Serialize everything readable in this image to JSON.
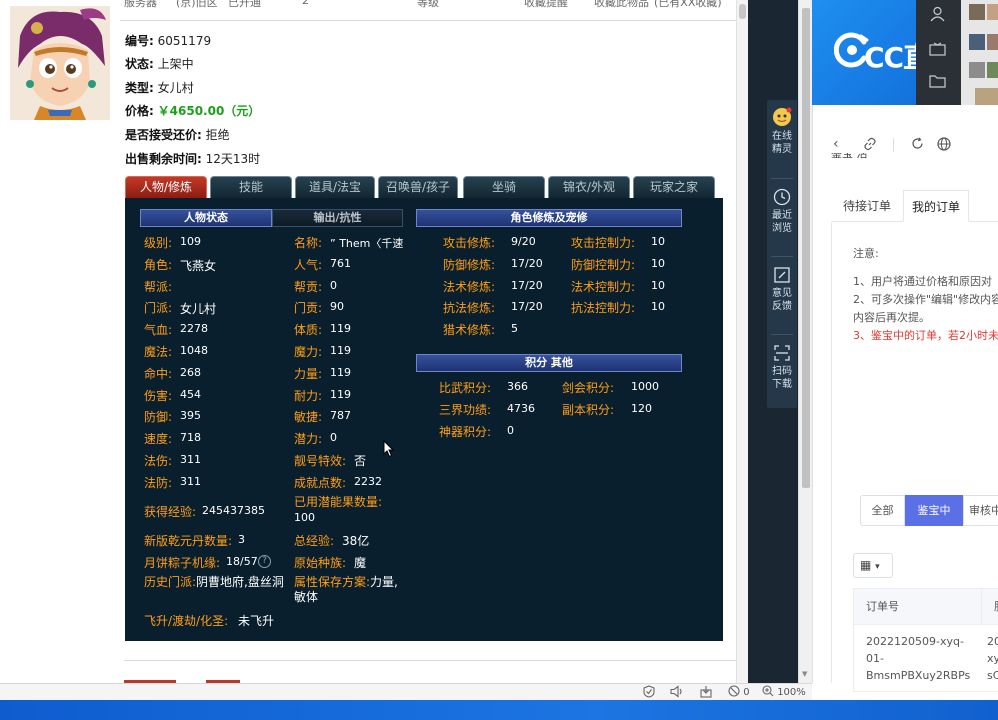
{
  "top_cut": [
    "服务器",
    "(京)旧区",
    "已开通",
    "2",
    "服务",
    "等级",
    "收藏提醒",
    "收藏此物品",
    "(已有XX收藏)"
  ],
  "info": {
    "id_label": "编号:",
    "id_value": "6051179",
    "status_label": "状态:",
    "status_value": "上架中",
    "type_label": "类型:",
    "type_value": "女儿村",
    "price_label": "价格:",
    "price_value": "￥4650.00（元）",
    "bargain_label": "是否接受还价:",
    "bargain_value": "拒绝",
    "remain_label": "出售剩余时间:",
    "remain_value": "12天13时"
  },
  "tabs": [
    "人物/修炼",
    "技能",
    "道具/法宝",
    "召唤兽/孩子",
    "坐骑",
    "锦衣/外观",
    "玩家之家"
  ],
  "panel": {
    "hdr_status": "人物状态",
    "hdr_output": "输出/抗性",
    "hdr_cultivation": "角色修炼及宠修",
    "hdr_score": "积分 其他",
    "stats_left": [
      {
        "k": "级别:",
        "v": "109"
      },
      {
        "k": "角色:",
        "v": "飞燕女"
      },
      {
        "k": "帮派:",
        "v": ""
      },
      {
        "k": "门派:",
        "v": "女儿村"
      },
      {
        "k": "气血:",
        "v": "2278"
      },
      {
        "k": "魔法:",
        "v": "1048"
      },
      {
        "k": "命中:",
        "v": "268"
      },
      {
        "k": "伤害:",
        "v": "454"
      },
      {
        "k": "防御:",
        "v": "395"
      },
      {
        "k": "速度:",
        "v": "718"
      },
      {
        "k": "法伤:",
        "v": "311"
      },
      {
        "k": "法防:",
        "v": "311"
      }
    ],
    "stats_right": [
      {
        "k": "名称:",
        "v": "” Them〈千速"
      },
      {
        "k": "人气:",
        "v": "761"
      },
      {
        "k": "帮贡:",
        "v": "0"
      },
      {
        "k": "门贡:",
        "v": "90"
      },
      {
        "k": "体质:",
        "v": "119"
      },
      {
        "k": "魔力:",
        "v": "119"
      },
      {
        "k": "力量:",
        "v": "119"
      },
      {
        "k": "耐力:",
        "v": "119"
      },
      {
        "k": "敏捷:",
        "v": "787"
      },
      {
        "k": "潜力:",
        "v": "0"
      },
      {
        "k": "靓号特效:",
        "v": "否"
      },
      {
        "k": "成就点数:",
        "v": "2232"
      }
    ],
    "exp_label": "获得经验:",
    "exp_value": "245437385",
    "potential_label": "已用潜能果数量:",
    "potential_value": "100",
    "qiankun_label": "新版乾元丹数量:",
    "qiankun_value": "3",
    "total_exp_label": "总经验:",
    "total_exp_value": "38亿",
    "mooncake_label": "月饼粽子机缘:",
    "mooncake_value": "18/57",
    "race_label": "原始种族:",
    "race_value": "魔",
    "history_label": "历史门派:",
    "history_value": "阴曹地府,盘丝洞",
    "attr_label": "属性保存方案:",
    "attr_value": "力量,敏体",
    "ascend_label": "飞升/渡劫/化圣:",
    "ascend_value": "未飞升",
    "cultivation": [
      {
        "k": "攻击修炼:",
        "v": "9/20",
        "k2": "攻击控制力:",
        "v2": "10"
      },
      {
        "k": "防御修炼:",
        "v": "17/20",
        "k2": "防御控制力:",
        "v2": "10"
      },
      {
        "k": "法术修炼:",
        "v": "17/20",
        "k2": "法术控制力:",
        "v2": "10"
      },
      {
        "k": "抗法修炼:",
        "v": "17/20",
        "k2": "抗法控制力:",
        "v2": "10"
      },
      {
        "k": "猎术修炼:",
        "v": "5",
        "k2": "",
        "v2": ""
      }
    ],
    "score": [
      {
        "k": "比武积分:",
        "v": "366",
        "k2": "剑会积分:",
        "v2": "1000"
      },
      {
        "k": "三界功绩:",
        "v": "4736",
        "k2": "副本积分:",
        "v2": "120"
      },
      {
        "k": "神器积分:",
        "v": "0",
        "k2": "",
        "v2": ""
      }
    ]
  },
  "sidebar": {
    "online": "在线精灵",
    "recent": "最近浏览",
    "feedback": "意见反馈",
    "download": "扫码下载"
  },
  "statusbar": {
    "icons": [
      "shield-icon",
      "speaker-icon",
      "download-icon",
      "blocked-icon"
    ],
    "blocked_count": "0",
    "zoom": "100%"
  },
  "cc": {
    "logo_text": "CC直播"
  },
  "orders": {
    "tab_pending": "待接订单",
    "tab_mine": "我的订单",
    "note_title": "注意:",
    "note1": "1、用户将通过价格和原因对",
    "note2": "2、可多次操作\"编辑\"修改内容",
    "note3": "内容后再次提。",
    "note4": "3、鉴宝中的订单，若2小时未",
    "filter_all": "全部",
    "filter_appraising": "鉴宝中",
    "filter_review": "审核中",
    "col_order": "订单号",
    "col_server": "服",
    "order_id": "2022120509-xyq-01-BmsmPBXuy2RBPs",
    "order_id_lines": [
      "2022120509-xyq-",
      "01-",
      "BmsmPBXuy2RBPs"
    ],
    "server_lines": [
      "20",
      "xy",
      "sC"
    ]
  },
  "colors": {
    "panel_bg": "#0a1f2d",
    "label_orange": "#ff9e17",
    "price_green": "#1aa11a",
    "active_tab": "#b12a19",
    "accent_blue": "#5b6fe6",
    "cc_blue": "#1a82e8"
  }
}
